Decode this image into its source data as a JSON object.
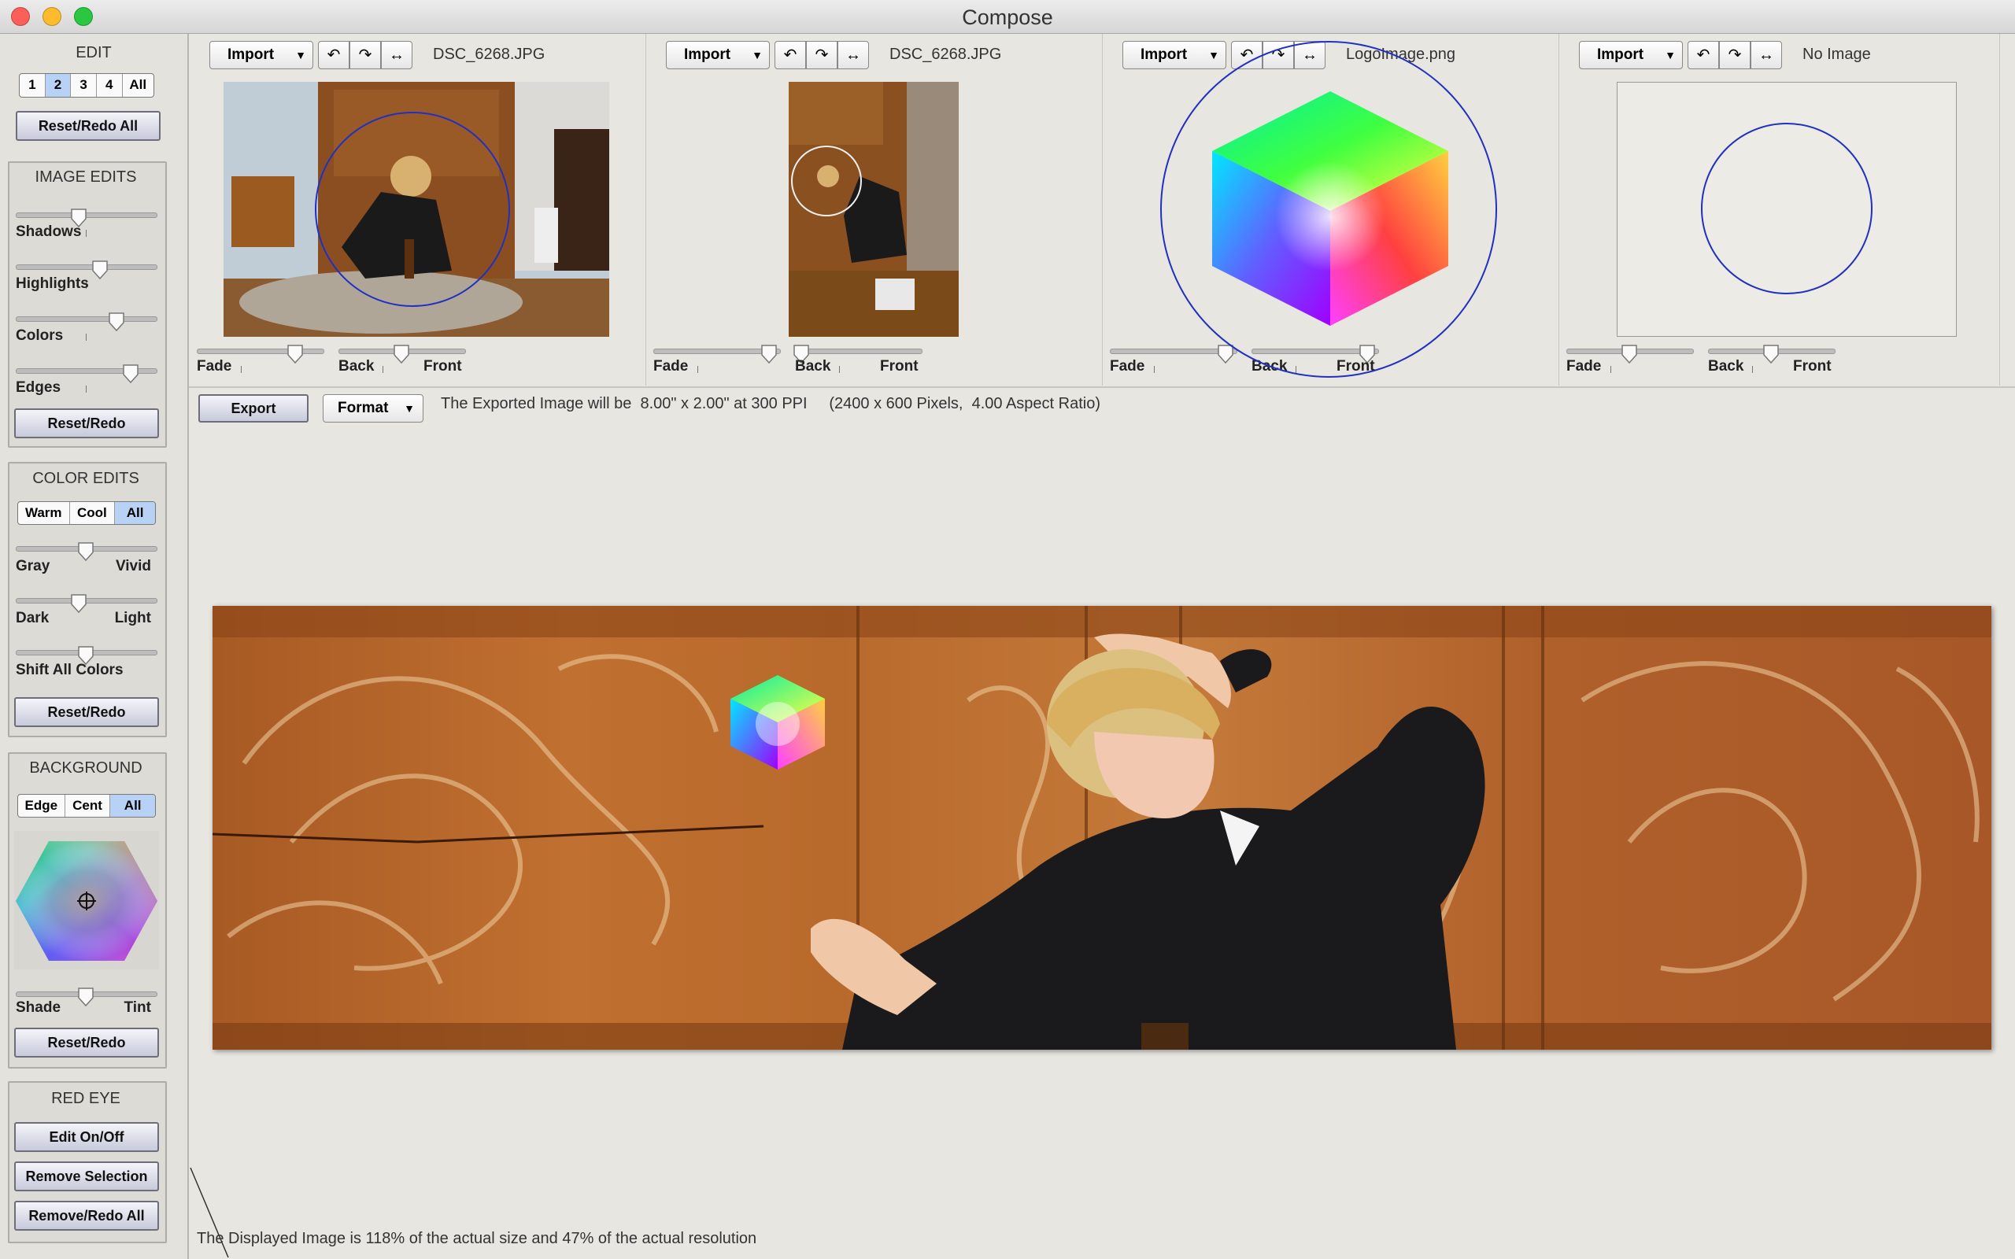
{
  "window": {
    "title": "Compose"
  },
  "sidebar": {
    "edit": {
      "heading": "EDIT",
      "tabs": [
        "1",
        "2",
        "3",
        "4",
        "All"
      ],
      "selected": "2",
      "reset_all": "Reset/Redo All"
    },
    "image_edits": {
      "heading": "IMAGE EDITS",
      "sliders": [
        {
          "label": "Shadows",
          "value": 0.45
        },
        {
          "label": "Highlights",
          "value": 0.6
        },
        {
          "label": "Colors",
          "value": 0.72
        },
        {
          "label": "Edges",
          "value": 0.82
        }
      ],
      "reset": "Reset/Redo"
    },
    "color_edits": {
      "heading": "COLOR EDITS",
      "tabs": [
        "Warm",
        "Cool",
        "All"
      ],
      "selected": "All",
      "sliders": [
        {
          "left": "Gray",
          "right": "Vivid",
          "value": 0.5
        },
        {
          "left": "Dark",
          "right": "Light",
          "value": 0.45
        },
        {
          "left": "Shift All Colors",
          "right": "",
          "value": 0.5
        }
      ],
      "reset": "Reset/Redo"
    },
    "background": {
      "heading": "BACKGROUND",
      "tabs": [
        "Edge",
        "Cent",
        "All"
      ],
      "selected": "All",
      "slider": {
        "left": "Shade",
        "right": "Tint",
        "value": 0.5
      },
      "reset": "Reset/Redo"
    },
    "red_eye": {
      "heading": "RED EYE",
      "buttons": [
        "Edit On/Off",
        "Remove Selection",
        "Remove/Redo All"
      ]
    }
  },
  "panels": [
    {
      "import": "Import",
      "filename": "DSC_6268.JPG",
      "fade_label": "Fade",
      "back_label": "Back",
      "front_label": "Front",
      "fade": 0.78,
      "backfront": 0.5
    },
    {
      "import": "Import",
      "filename": "DSC_6268.JPG",
      "fade_label": "Fade",
      "back_label": "Back",
      "front_label": "Front",
      "fade": 0.92,
      "backfront": 0.05
    },
    {
      "import": "Import",
      "filename": "LogoImage.png",
      "fade_label": "Fade",
      "back_label": "Back",
      "front_label": "Front",
      "fade": 0.92,
      "backfront": 0.92
    },
    {
      "import": "Import",
      "filename": "No Image",
      "fade_label": "Fade",
      "back_label": "Back",
      "front_label": "Front",
      "fade": 0.5,
      "backfront": 0.5
    }
  ],
  "icons": {
    "rotate_left": "↶",
    "rotate_right": "↷",
    "flip": "↔"
  },
  "export": {
    "button": "Export",
    "format": "Format",
    "info": "The Exported Image will be  8.00\" x 2.00\" at 300 PPI     (2400 x 600 Pixels,  4.00 Aspect Ratio)"
  },
  "status": "The Displayed Image is 118% of the actual size and 47% of the actual resolution"
}
